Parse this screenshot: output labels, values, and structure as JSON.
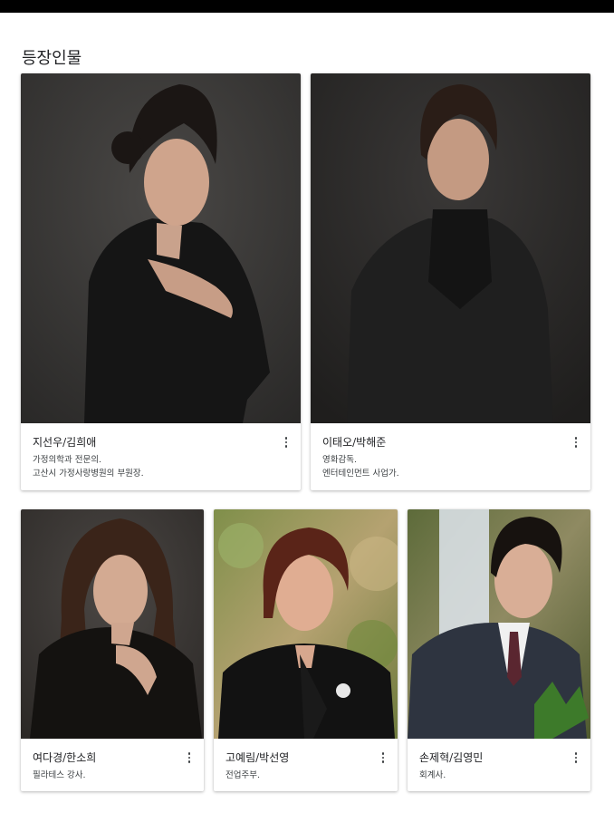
{
  "section": {
    "title": "등장인물"
  },
  "characters": [
    {
      "name": "지선우/김희애",
      "desc_lines": [
        "가정의학과 전문의.",
        "고산시 가정사랑병원의 부원장."
      ]
    },
    {
      "name": "이태오/박해준",
      "desc_lines": [
        "영화감독.",
        "엔터테인먼트 사업가."
      ]
    },
    {
      "name": "여다경/한소희",
      "desc_lines": [
        "필라테스 강사."
      ]
    },
    {
      "name": "고예림/박선영",
      "desc_lines": [
        "전업주부."
      ]
    },
    {
      "name": "손제혁/김영민",
      "desc_lines": [
        "회계사."
      ]
    }
  ],
  "icons": {
    "more": "more-vert-icon"
  }
}
